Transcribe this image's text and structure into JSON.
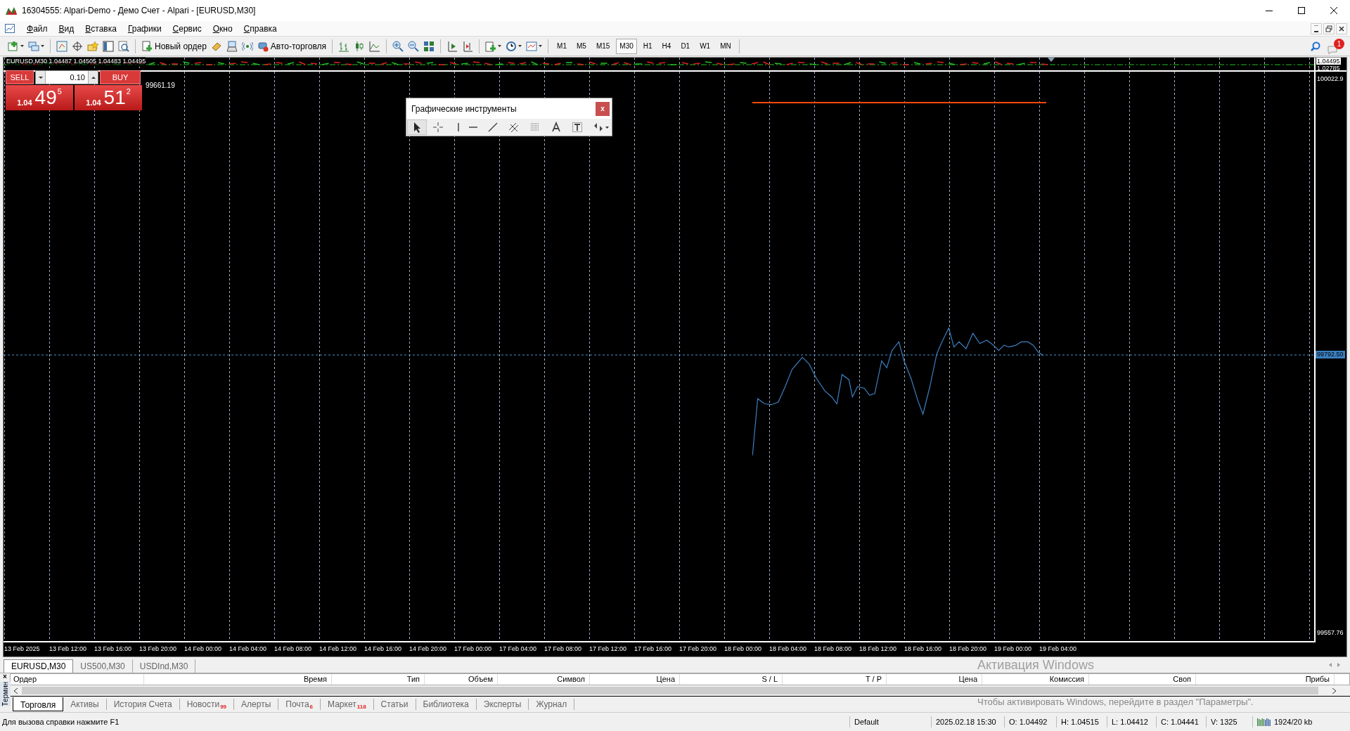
{
  "window": {
    "title": "16304555: Alpari-Demo - Демо Счет - Alpari - [EURUSD,M30]"
  },
  "menu": [
    {
      "label": "Файл"
    },
    {
      "label": "Вид"
    },
    {
      "label": "Вставка"
    },
    {
      "label": "Графики"
    },
    {
      "label": "Сервис"
    },
    {
      "label": "Окно"
    },
    {
      "label": "Справка"
    }
  ],
  "toolbar": {
    "new_order": "Новый ордер",
    "auto_trading": "Авто-торговля",
    "notifications": "1",
    "timeframes": [
      {
        "label": "M1",
        "selected": false
      },
      {
        "label": "M5",
        "selected": false
      },
      {
        "label": "M15",
        "selected": false
      },
      {
        "label": "M30",
        "selected": true
      },
      {
        "label": "H1",
        "selected": false
      },
      {
        "label": "H4",
        "selected": false
      },
      {
        "label": "D1",
        "selected": false
      },
      {
        "label": "W1",
        "selected": false
      },
      {
        "label": "MN",
        "selected": false
      }
    ]
  },
  "chart": {
    "indicator_header": "EURUSD,M30 1.04487 1.04505 1.04483 1.04495",
    "upper_axis": [
      {
        "text": "1.04495",
        "kind": "current"
      },
      {
        "text": "1.02785",
        "kind": "plain"
      }
    ],
    "one_click": {
      "sell": "SELL",
      "buy": "BUY",
      "lot": "0.10",
      "prices": [
        {
          "prefix": "1.04",
          "big": "49",
          "small": "5"
        },
        {
          "prefix": "1.04",
          "big": "51",
          "small": "2"
        }
      ]
    },
    "equity_label": "99661.19",
    "price_axis": [
      {
        "text": "100022.9",
        "kind": "plain"
      },
      {
        "text": "99792.50",
        "kind": "current"
      },
      {
        "text": "99557.76",
        "kind": "plain"
      }
    ],
    "time_axis": [
      "13 Feb 2025",
      "13 Feb 12:00",
      "13 Feb 16:00",
      "13 Feb 20:00",
      "14 Feb 00:00",
      "14 Feb 04:00",
      "14 Feb 08:00",
      "14 Feb 12:00",
      "14 Feb 16:00",
      "14 Feb 20:00",
      "17 Feb 00:00",
      "17 Feb 04:00",
      "17 Feb 08:00",
      "17 Feb 12:00",
      "17 Feb 16:00",
      "17 Feb 20:00",
      "18 Feb 00:00",
      "18 Feb 04:00",
      "18 Feb 08:00",
      "18 Feb 12:00",
      "18 Feb 16:00",
      "18 Feb 20:00",
      "19 Feb 00:00",
      "19 Feb 04:00"
    ]
  },
  "graphic_tools": {
    "title": "Графические инструменты",
    "close": "x",
    "tools": [
      {
        "kind": "cursor",
        "selected": true
      },
      {
        "kind": "crosshair",
        "selected": false
      },
      {
        "kind": "vline",
        "selected": false
      },
      {
        "kind": "hline",
        "selected": false
      },
      {
        "kind": "trend",
        "selected": false
      },
      {
        "kind": "channel",
        "selected": false
      },
      {
        "kind": "fibo",
        "selected": false
      },
      {
        "kind": "text",
        "selected": false
      },
      {
        "kind": "label",
        "selected": false
      },
      {
        "kind": "arrows",
        "selected": false
      }
    ]
  },
  "chart_tabs": [
    {
      "label": "EURUSD,M30",
      "selected": true
    },
    {
      "label": "US500,M30",
      "selected": false
    },
    {
      "label": "USDInd,M30",
      "selected": false
    }
  ],
  "terminal": {
    "side_label": "Термин",
    "close": "×",
    "columns": [
      "Ордер",
      "Время",
      "Тип",
      "Объем",
      "Символ",
      "Цена",
      "S / L",
      "T / P",
      "Цена",
      "Комиссия",
      "Своп",
      "Прибы"
    ],
    "tabs": [
      {
        "label": "Торговля",
        "selected": true
      },
      {
        "label": "Активы",
        "selected": false
      },
      {
        "label": "История Счета",
        "selected": false
      },
      {
        "label": "Новости",
        "badge": "99",
        "selected": false
      },
      {
        "label": "Алерты",
        "selected": false
      },
      {
        "label": "Почта",
        "badge": "6",
        "selected": false
      },
      {
        "label": "Маркет",
        "badge": "118",
        "selected": false
      },
      {
        "label": "Статьи",
        "selected": false
      },
      {
        "label": "Библиотека",
        "selected": false
      },
      {
        "label": "Эксперты",
        "selected": false
      },
      {
        "label": "Журнал",
        "selected": false
      }
    ]
  },
  "activation": {
    "title": "Активация Windows",
    "text": "Чтобы активировать Windows, перейдите в раздел \"Параметры\"."
  },
  "status_bar": {
    "help": "Для вызова справки нажмите F1",
    "profile": "Default",
    "time": "2025.02.18 15:30",
    "open": "O: 1.04492",
    "high": "H: 1.04515",
    "low": "L: 1.04412",
    "close": "C: 1.04441",
    "volume": "V: 1325",
    "traffic": "1924/20 kb"
  }
}
